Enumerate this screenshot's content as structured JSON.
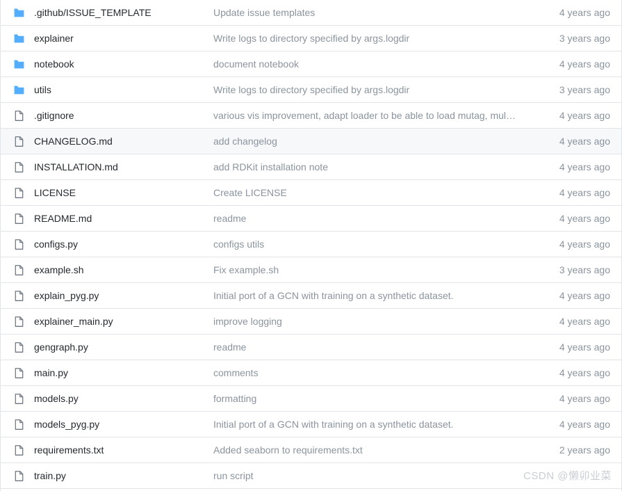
{
  "theme": {
    "folder_icon_color": "#54aeff",
    "file_icon_color": "#6e7781",
    "row_border_color": "#e1e4e8",
    "highlight_row_bg": "#f6f8fa",
    "name_text_color": "#24292f",
    "muted_text_color": "#8a949e",
    "watermark_color": "#c9ced4",
    "background": "#ffffff"
  },
  "watermark": {
    "prefix": "CSDN @",
    "handle": "懒卯业菜"
  },
  "file_list": {
    "rows": [
      {
        "icon": "folder-icon",
        "type": "folder",
        "name": ".github/ISSUE_TEMPLATE",
        "message": "Update issue templates",
        "age": "4 years ago",
        "highlighted": false
      },
      {
        "icon": "folder-icon",
        "type": "folder",
        "name": "explainer",
        "message": "Write logs to directory specified by args.logdir",
        "age": "3 years ago",
        "highlighted": false
      },
      {
        "icon": "folder-icon",
        "type": "folder",
        "name": "notebook",
        "message": "document notebook",
        "age": "4 years ago",
        "highlighted": false
      },
      {
        "icon": "folder-icon",
        "type": "folder",
        "name": "utils",
        "message": "Write logs to directory specified by args.logdir",
        "age": "3 years ago",
        "highlighted": false
      },
      {
        "icon": "file-icon",
        "type": "file",
        "name": ".gitignore",
        "message": "various vis improvement, adapt loader to be able to load mutag, multi...",
        "age": "4 years ago",
        "highlighted": false
      },
      {
        "icon": "file-icon",
        "type": "file",
        "name": "CHANGELOG.md",
        "message": "add changelog",
        "age": "4 years ago",
        "highlighted": true
      },
      {
        "icon": "file-icon",
        "type": "file",
        "name": "INSTALLATION.md",
        "message": "add RDKit installation note",
        "age": "4 years ago",
        "highlighted": false
      },
      {
        "icon": "file-icon",
        "type": "file",
        "name": "LICENSE",
        "message": "Create LICENSE",
        "age": "4 years ago",
        "highlighted": false
      },
      {
        "icon": "file-icon",
        "type": "file",
        "name": "README.md",
        "message": "readme",
        "age": "4 years ago",
        "highlighted": false
      },
      {
        "icon": "file-icon",
        "type": "file",
        "name": "configs.py",
        "message": "configs utils",
        "age": "4 years ago",
        "highlighted": false
      },
      {
        "icon": "file-icon",
        "type": "file",
        "name": "example.sh",
        "message": "Fix example.sh",
        "age": "3 years ago",
        "highlighted": false
      },
      {
        "icon": "file-icon",
        "type": "file",
        "name": "explain_pyg.py",
        "message": "Initial port of a GCN with training on a synthetic dataset.",
        "age": "4 years ago",
        "highlighted": false
      },
      {
        "icon": "file-icon",
        "type": "file",
        "name": "explainer_main.py",
        "message": "improve logging",
        "age": "4 years ago",
        "highlighted": false
      },
      {
        "icon": "file-icon",
        "type": "file",
        "name": "gengraph.py",
        "message": "readme",
        "age": "4 years ago",
        "highlighted": false
      },
      {
        "icon": "file-icon",
        "type": "file",
        "name": "main.py",
        "message": "comments",
        "age": "4 years ago",
        "highlighted": false
      },
      {
        "icon": "file-icon",
        "type": "file",
        "name": "models.py",
        "message": "formatting",
        "age": "4 years ago",
        "highlighted": false
      },
      {
        "icon": "file-icon",
        "type": "file",
        "name": "models_pyg.py",
        "message": "Initial port of a GCN with training on a synthetic dataset.",
        "age": "4 years ago",
        "highlighted": false
      },
      {
        "icon": "file-icon",
        "type": "file",
        "name": "requirements.txt",
        "message": "Added seaborn to requirements.txt",
        "age": "2 years ago",
        "highlighted": false
      },
      {
        "icon": "file-icon",
        "type": "file",
        "name": "train.py",
        "message": "run script",
        "age": "",
        "highlighted": false
      }
    ]
  }
}
